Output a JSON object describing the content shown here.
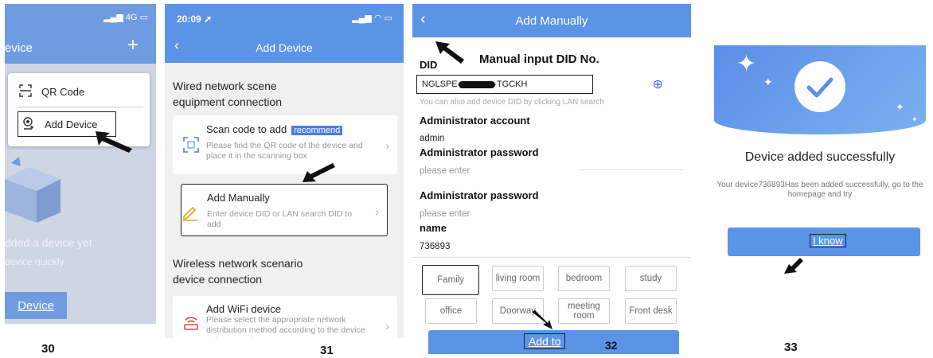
{
  "panel1": {
    "signal": "4G",
    "title": "evice",
    "plus_icon": "+",
    "menu": {
      "qr_label": "QR Code",
      "add_label": "Add Device"
    },
    "empty_title": "dded a device yet",
    "empty_sub": "device quickly",
    "add_button": "Device",
    "step": "30"
  },
  "panel2": {
    "time": "20:09",
    "title": "Add Device",
    "wired_heading_1": "Wired network scene",
    "wired_heading_2": "equipment connection",
    "scan": {
      "title": "Scan code to add",
      "badge": "recommend",
      "desc": "Please find the QR code of the device and place it in the scanning box"
    },
    "manual": {
      "title": "Add Manually",
      "desc": "Enter device DID or LAN search DID to add"
    },
    "wireless_heading_1": "Wireless network scenario",
    "wireless_heading_2": "device connection",
    "wifi": {
      "title": "Add WiFi device",
      "desc": "Please select the appropriate network distribution method according to the device voice prompts"
    },
    "step": "31"
  },
  "panel3": {
    "title": "Add Manually",
    "did_label": "DID",
    "annotation": "Manual input DID No.",
    "did_prefix": "NGLSPE-",
    "did_suffix": "-TGCKH",
    "lan_hint": "You can also add device DID by clicking LAN search",
    "admin_account_label": "Administrator account",
    "admin_account_value": "admin",
    "admin_password_label": "Administrator password",
    "admin_password_placeholder": "please enter",
    "admin_password_label_2": "Administrator password",
    "admin_password_placeholder_2": "please enter",
    "name_label": "name",
    "name_value": "736893",
    "rooms": [
      "Family",
      "living room",
      "bedroom",
      "study",
      "office",
      "Doorway",
      "meeting room",
      "Front desk"
    ],
    "selected_room": "Family",
    "add_button": "Add to",
    "step": "32"
  },
  "panel4": {
    "success_title": "Device added successfully",
    "message": "Your device736893Has been added successfully, go to the homepage and try",
    "button": "I know",
    "step": "33"
  },
  "colors": {
    "primary": "#5b93e6",
    "accent": "#3d6fd8",
    "badge": "#4b7ee0"
  }
}
